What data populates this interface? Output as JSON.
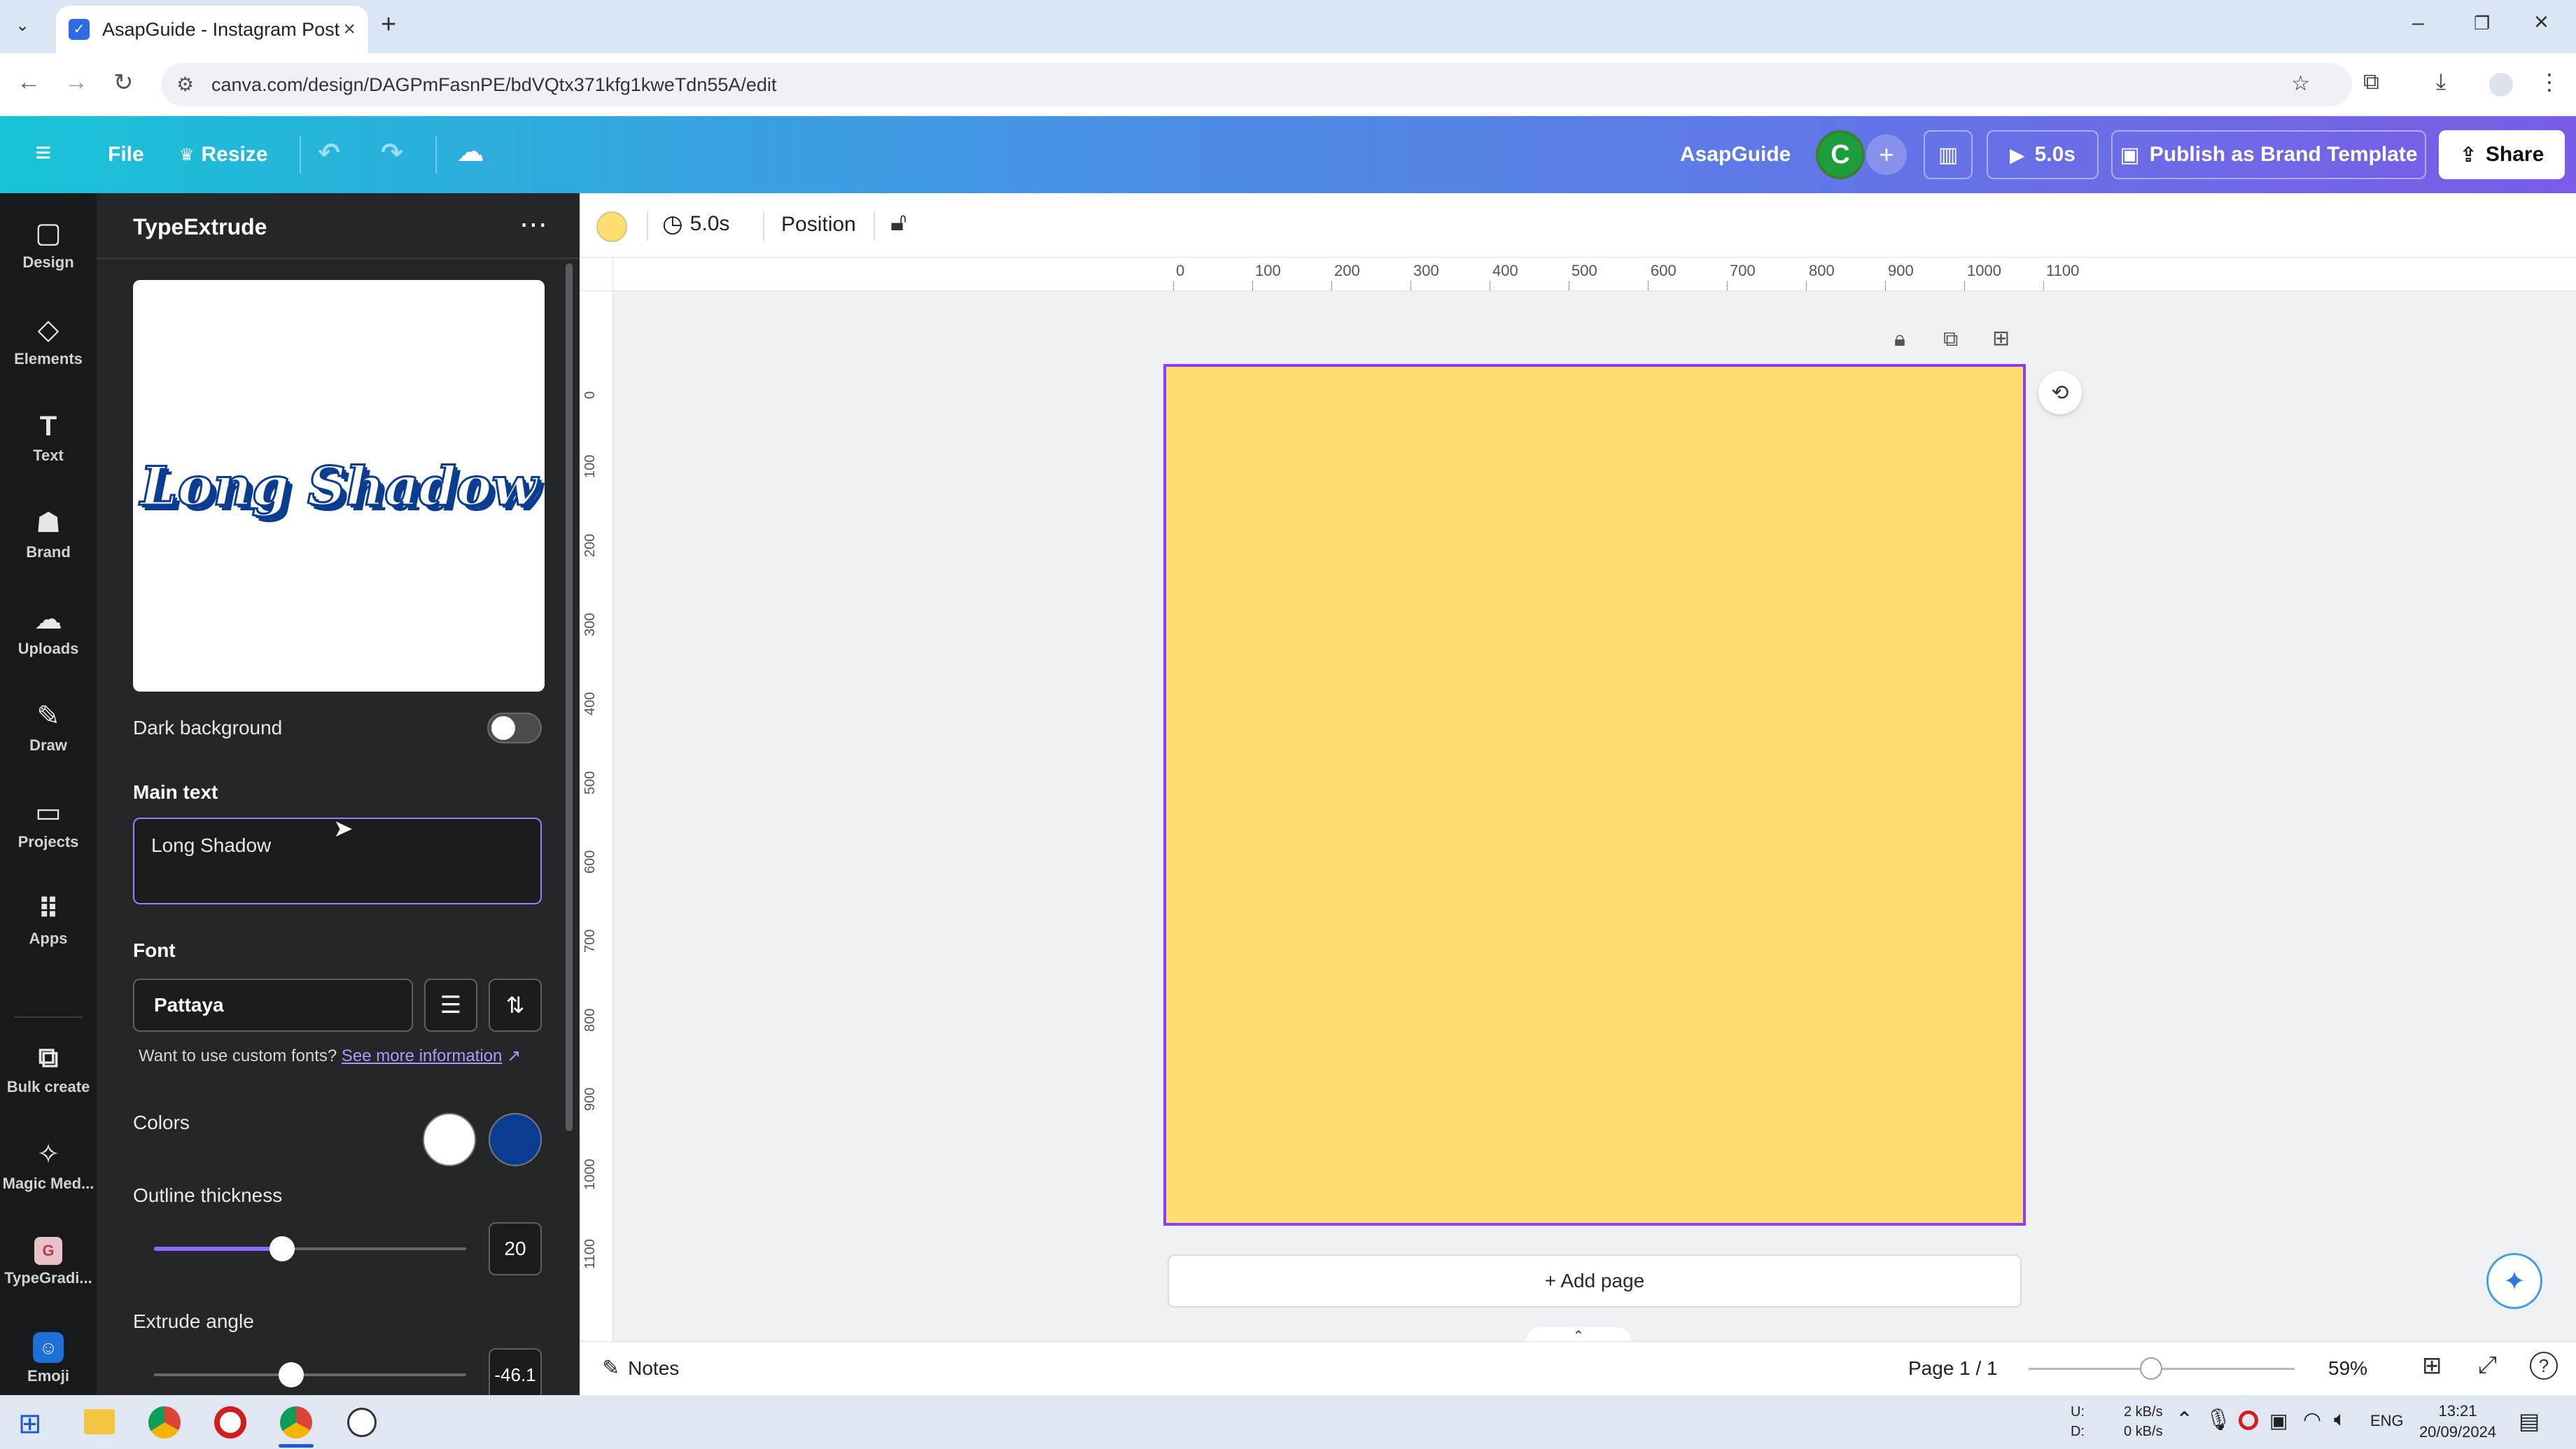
{
  "browser": {
    "tab_title": "AsapGuide - Instagram Post",
    "url": "canva.com/design/DAGPmFasnPE/bdVQtx371kfg1kweTdn55A/edit",
    "window_controls": [
      "minimize-icon",
      "restore-icon",
      "close-icon"
    ]
  },
  "topbar": {
    "file_label": "File",
    "resize_label": "Resize",
    "design_title": "AsapGuide",
    "avatar_letter": "C",
    "play_duration": "5.0s",
    "publish_label": "Publish as Brand Template",
    "share_label": "Share"
  },
  "rail": {
    "items": [
      {
        "label": "Design",
        "icon": "design-icon"
      },
      {
        "label": "Elements",
        "icon": "elements-icon"
      },
      {
        "label": "Text",
        "icon": "text-icon"
      },
      {
        "label": "Brand",
        "icon": "brand-icon"
      },
      {
        "label": "Uploads",
        "icon": "uploads-icon"
      },
      {
        "label": "Draw",
        "icon": "draw-icon"
      },
      {
        "label": "Projects",
        "icon": "projects-icon"
      },
      {
        "label": "Apps",
        "icon": "apps-icon"
      },
      {
        "label": "Bulk create",
        "icon": "bulk-create-icon"
      },
      {
        "label": "Magic Med...",
        "icon": "magic-media-icon"
      },
      {
        "label": "TypeGradi...",
        "icon": "typegradient-icon"
      },
      {
        "label": "Emoji",
        "icon": "emoji-icon"
      }
    ]
  },
  "panel": {
    "title": "TypeExtrude",
    "preview_text": "Long Shadow",
    "dark_background_label": "Dark background",
    "dark_background_on": false,
    "main_text_label": "Main text",
    "main_text_value": "Long Shadow",
    "font_label": "Font",
    "font_value": "Pattaya",
    "custom_fonts_text": "Want to use custom fonts?",
    "see_more_link": "See more information",
    "colors_label": "Colors",
    "color_1": "#ffffff",
    "color_2": "#0a3d91",
    "outline_label": "Outline thickness",
    "outline_value": "20",
    "outline_fraction": 0.41,
    "extrude_label": "Extrude angle",
    "extrude_value": "-46.1",
    "extrude_fraction": 0.44
  },
  "context_bar": {
    "color_swatch": "#ffdd6e",
    "duration": "5.0s",
    "position_label": "Position"
  },
  "rulers": {
    "h_ticks": [
      "0",
      "100",
      "200",
      "300",
      "400",
      "500",
      "600",
      "700",
      "800",
      "900",
      "1000",
      "1100"
    ],
    "v_ticks": [
      "0",
      "100",
      "200",
      "300",
      "400",
      "500",
      "600",
      "700",
      "800",
      "900",
      "1000",
      "1100"
    ]
  },
  "canvas": {
    "background": "#ffdd6e",
    "add_page_label": "+ Add page"
  },
  "bottombar": {
    "notes_label": "Notes",
    "page_indicator": "Page 1 / 1",
    "zoom": "59%",
    "zoom_fraction": 0.46
  },
  "taskbar": {
    "net_up_label": "U:",
    "net_down_label": "D:",
    "net_up": "2 kB/s",
    "net_down": "0 kB/s",
    "language": "ENG",
    "time": "13:21",
    "date": "20/09/2024"
  }
}
